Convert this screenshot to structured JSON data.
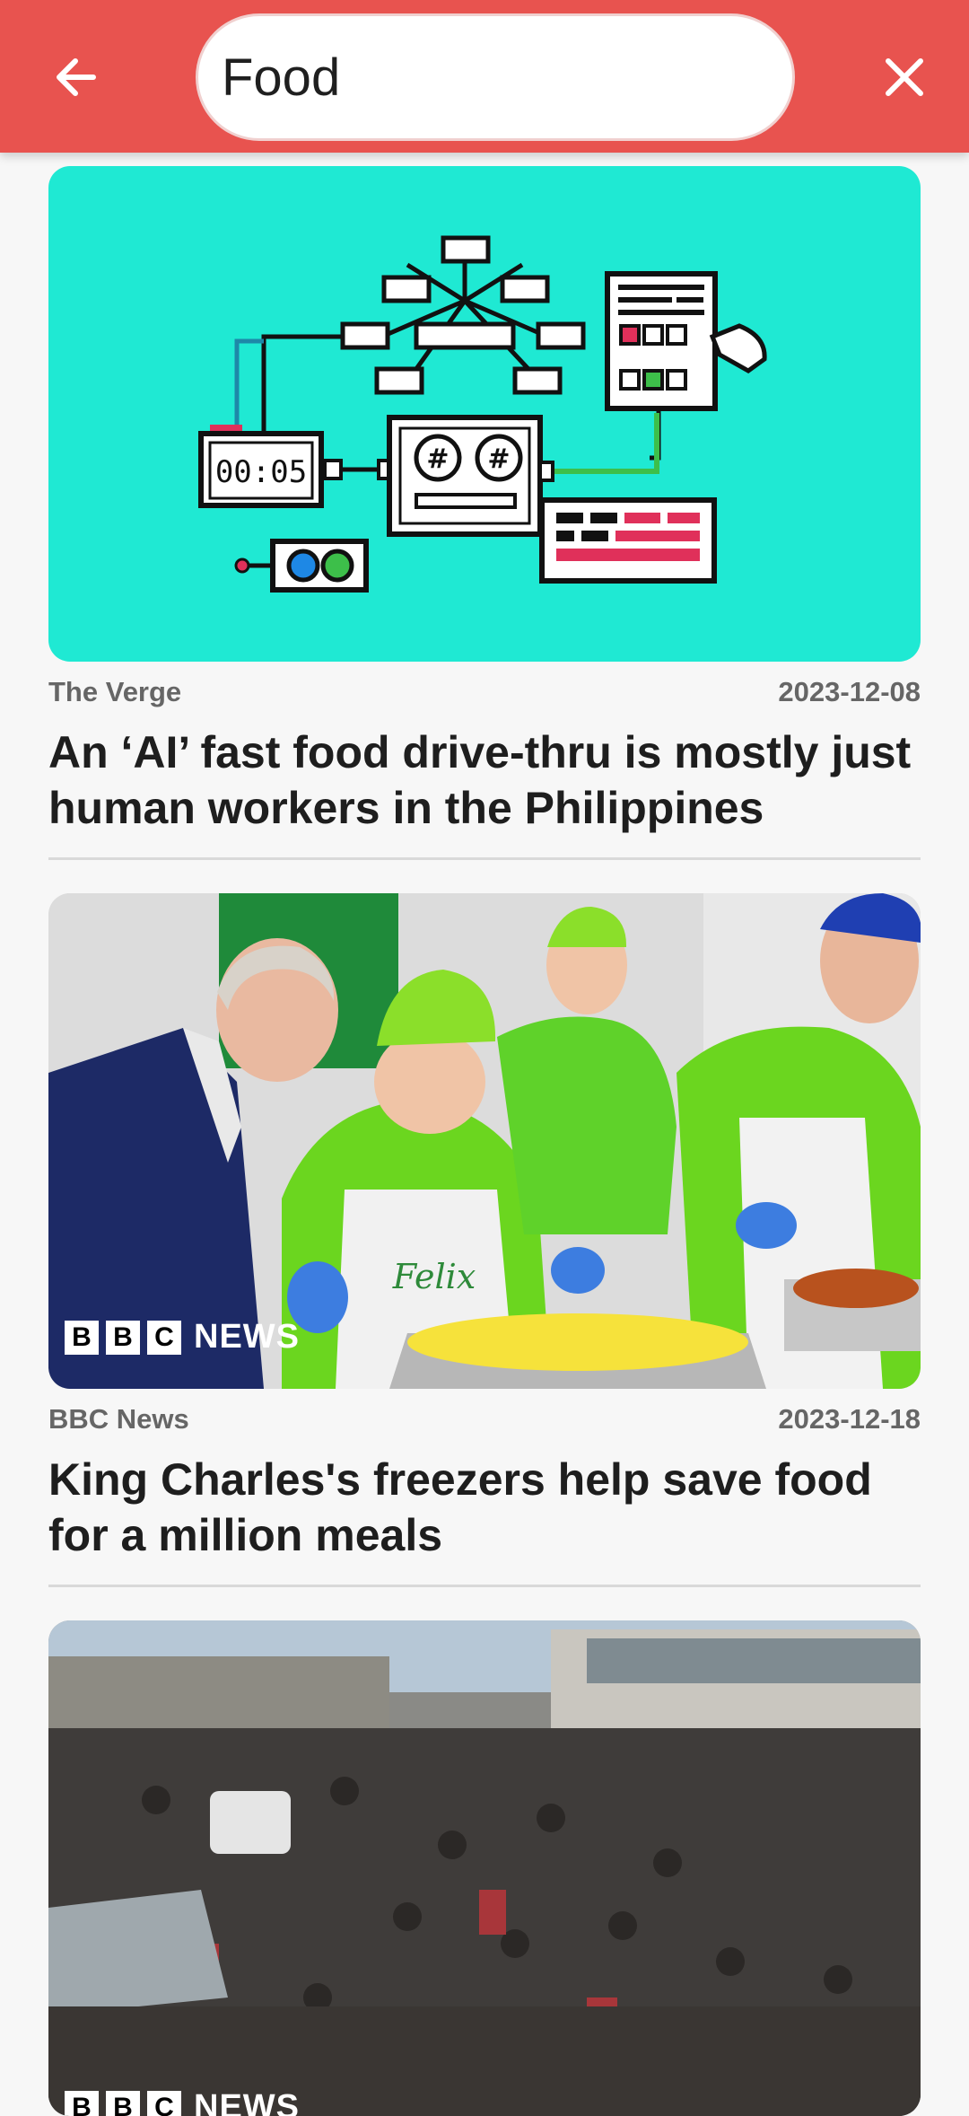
{
  "search": {
    "value": "Food",
    "back_icon": "arrow-left-icon",
    "close_icon": "close-icon"
  },
  "colors": {
    "topbar": "#e8534f",
    "background": "#f7f7f7",
    "illustration_bg": "#1fe9d3"
  },
  "articles": [
    {
      "source": "The Verge",
      "date": "2023-12-08",
      "title": "An ‘AI’ fast food drive-thru is mostly just human workers in the Philippines",
      "image_timer_text": "00:05"
    },
    {
      "source": "BBC News",
      "date": "2023-12-18",
      "title": "King Charles's freezers help save food for a million meals",
      "logo": {
        "b1": "B",
        "b2": "B",
        "b3": "C",
        "news": "NEWS"
      },
      "apron_text": "Felix"
    },
    {
      "logo": {
        "b1": "B",
        "b2": "B",
        "b3": "C",
        "news": "NEWS"
      }
    }
  ]
}
